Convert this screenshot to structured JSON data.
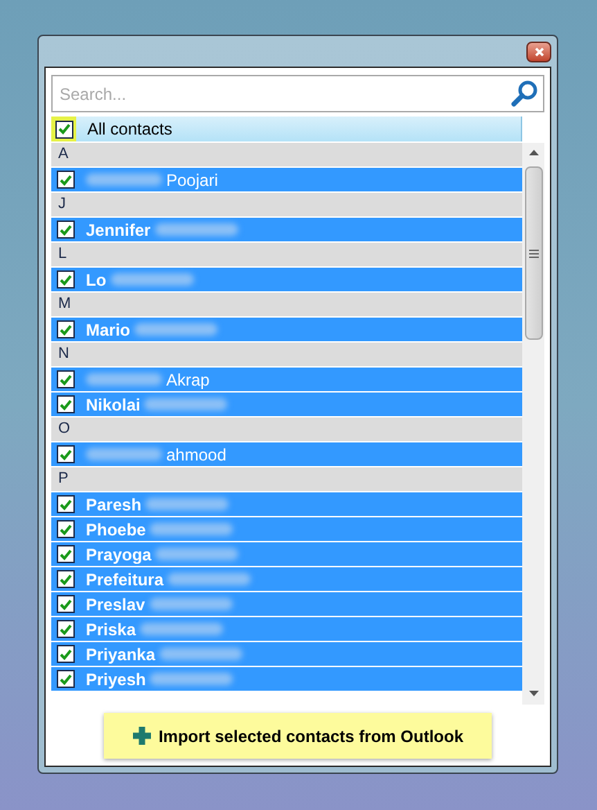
{
  "search": {
    "placeholder": "Search..."
  },
  "all_contacts": {
    "label": "All contacts",
    "checked": true
  },
  "groups": [
    {
      "letter": "A",
      "contacts": [
        {
          "name": "Poojari",
          "kind": "last",
          "checked": true
        }
      ]
    },
    {
      "letter": "J",
      "contacts": [
        {
          "name": "Jennifer",
          "kind": "first",
          "checked": true
        }
      ]
    },
    {
      "letter": "L",
      "contacts": [
        {
          "name": "Lo",
          "kind": "first",
          "checked": true
        }
      ]
    },
    {
      "letter": "M",
      "contacts": [
        {
          "name": "Mario",
          "kind": "first",
          "checked": true
        }
      ]
    },
    {
      "letter": "N",
      "contacts": [
        {
          "name": "Akrap",
          "kind": "last",
          "checked": true
        },
        {
          "name": "Nikolai",
          "kind": "first",
          "checked": true
        }
      ]
    },
    {
      "letter": "O",
      "contacts": [
        {
          "name": "ahmood",
          "kind": "last",
          "checked": true
        }
      ]
    },
    {
      "letter": "P",
      "contacts": [
        {
          "name": "Paresh",
          "kind": "first",
          "checked": true
        },
        {
          "name": "Phoebe",
          "kind": "first",
          "checked": true
        },
        {
          "name": "Prayoga",
          "kind": "first",
          "checked": true
        },
        {
          "name": "Prefeitura",
          "kind": "first",
          "checked": true
        },
        {
          "name": "Preslav",
          "kind": "first",
          "checked": true
        },
        {
          "name": "Priska",
          "kind": "first",
          "checked": true
        },
        {
          "name": "Priyanka",
          "kind": "first",
          "checked": true
        },
        {
          "name": "Priyesh",
          "kind": "first",
          "checked": true
        }
      ]
    }
  ],
  "import_button": {
    "label": "Import selected contacts from Outlook"
  }
}
